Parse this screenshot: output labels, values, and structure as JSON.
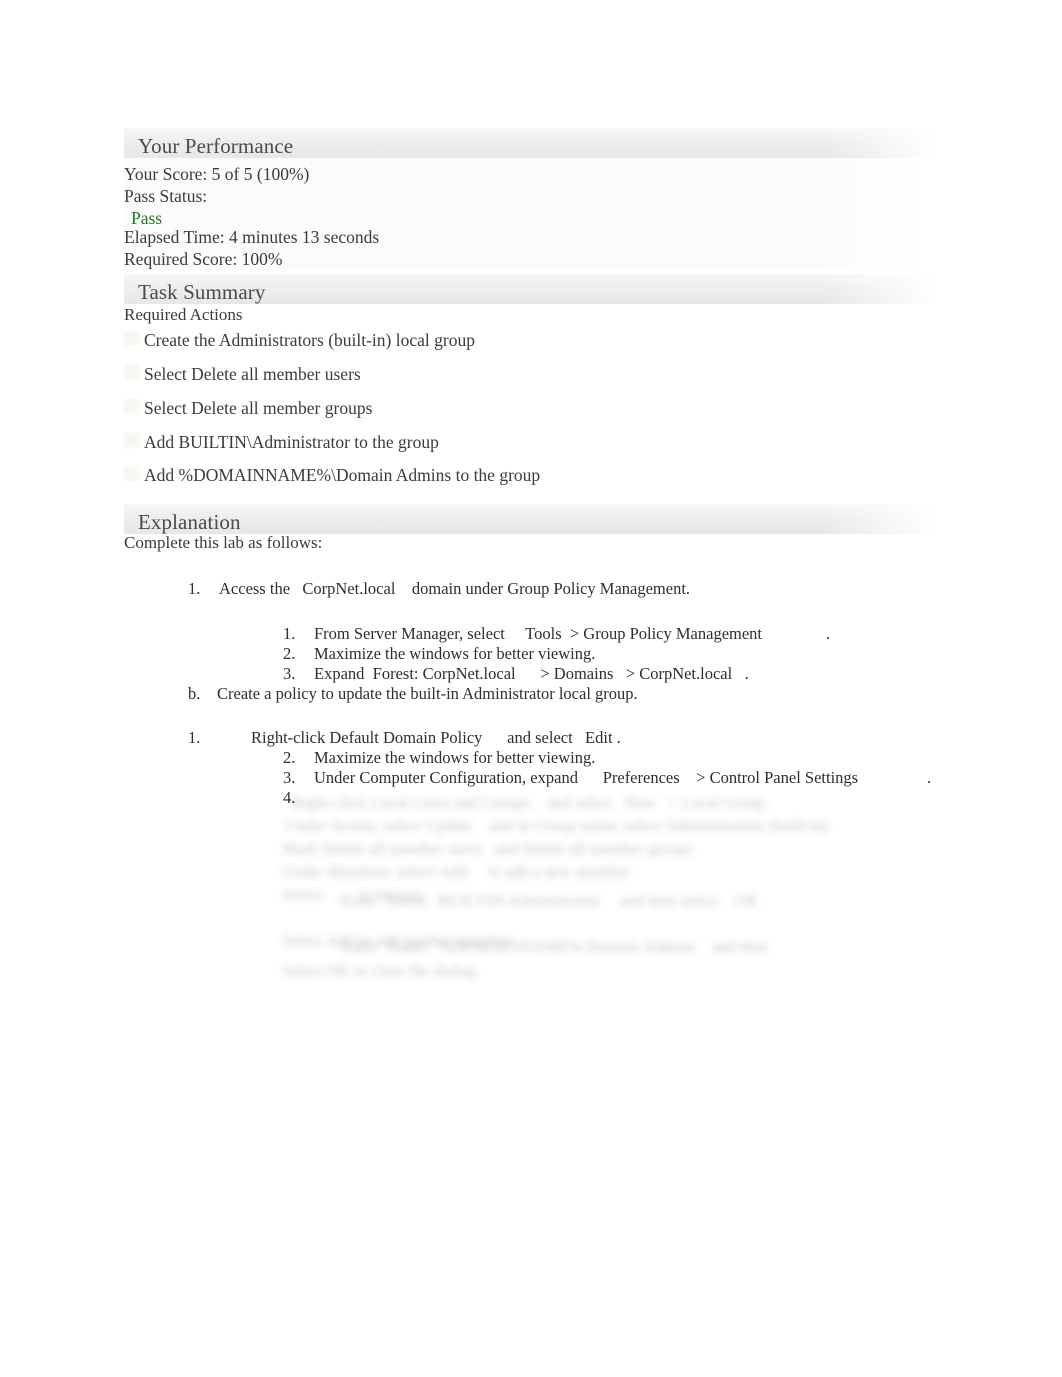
{
  "document": {
    "sections": [
      {
        "id": "performance",
        "title": "Your Performance"
      },
      {
        "id": "task_summary",
        "title": "Task Summary"
      },
      {
        "id": "explanation",
        "title": "Explanation"
      }
    ]
  },
  "performance": {
    "title": "Your Performance",
    "score_label": "Your Score: 5 of 5 (100%)",
    "pass_status_label": "Pass Status:",
    "pass_value": "Pass",
    "pass_color": "#1f7a1f",
    "elapsed_time_label": "Elapsed Time: 4 minutes 13 seconds",
    "required_score_label": "Required Score: 100%"
  },
  "task_summary": {
    "title": "Task Summary",
    "required_actions_heading": "Required Actions",
    "actions": [
      {
        "icon": "check-icon",
        "label": "Create the Administrators (built-in) local group"
      },
      {
        "icon": "check-icon",
        "label": "Select Delete all member users"
      },
      {
        "icon": "check-icon",
        "label": "Select Delete all member groups"
      },
      {
        "icon": "check-icon",
        "label": "Add BUILTIN\\Administrator to the group"
      },
      {
        "icon": "check-icon",
        "label": "Add %DOMAINNAME%\\Domain Admins to the group"
      }
    ]
  },
  "explanation": {
    "title": "Explanation",
    "intro": "Complete this lab as follows:",
    "steps": [
      {
        "marker": "1.",
        "text": "Access the   CorpNet.local    domain under Group Policy Management."
      },
      {
        "marker": "1.",
        "text": "From Server Manager, select     Tools  > Group Policy Management"
      },
      {
        "marker": "1_trailing",
        "text": "."
      },
      {
        "marker": "2.",
        "text": "Maximize the windows for better viewing."
      },
      {
        "marker": "3.",
        "text": "Expand  Forest: CorpNet.local      > Domains   > CorpNet.local   ."
      },
      {
        "marker": "b.",
        "text": "Create a policy to update the built-in Administrator local group."
      },
      {
        "marker": "1.",
        "text": "Right-click Default Domain Policy      and select   Edit ."
      },
      {
        "marker": "2.",
        "text": "Maximize the windows for better viewing."
      },
      {
        "marker": "3.",
        "text": "Under Computer Configuration, expand      Preferences    > Control Panel Settings"
      },
      {
        "marker": "3_trailing",
        "text": "."
      },
      {
        "marker": "4.",
        "text": ""
      }
    ],
    "redacted_note": "Remaining steps are blurred and illegible in the source document."
  }
}
